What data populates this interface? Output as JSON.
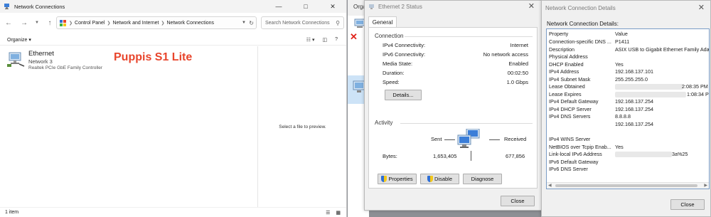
{
  "nc": {
    "title": "Network Connections",
    "addr_segments": [
      "Control Panel",
      "Network and Internet",
      "Network Connections"
    ],
    "search_placeholder": "Search Network Connections",
    "organize": "Organize",
    "item": {
      "name": "Ethernet",
      "network": "Network 3",
      "device": "Realtek PCIe GbE Family Controller"
    },
    "overlay_text": "Puppis S1 Lite",
    "preview_text": "Select a file to preview.",
    "status_text": "1 item"
  },
  "mid": {
    "org": "Orga"
  },
  "status": {
    "title": "Ethernet 2 Status",
    "tab": "General",
    "connection_label": "Connection",
    "rows": [
      {
        "k": "IPv4 Connectivity:",
        "v": "Internet"
      },
      {
        "k": "IPv6 Connectivity:",
        "v": "No network access"
      },
      {
        "k": "Media State:",
        "v": "Enabled"
      },
      {
        "k": "Duration:",
        "v": "00:02:50"
      },
      {
        "k": "Speed:",
        "v": "1.0 Gbps"
      }
    ],
    "details_btn": "Details...",
    "activity_label": "Activity",
    "sent_label": "Sent",
    "received_label": "Received",
    "bytes_label": "Bytes:",
    "bytes_sent": "1,653,405",
    "bytes_received": "677,856",
    "properties_btn": "Properties",
    "disable_btn": "Disable",
    "diagnose_btn": "Diagnose",
    "close_btn": "Close"
  },
  "details": {
    "title": "Network Connection Details",
    "label": "Network Connection Details:",
    "header": {
      "p": "Property",
      "v": "Value"
    },
    "rows": [
      {
        "p": "Connection-specific DNS ...",
        "v": "P1411"
      },
      {
        "p": "Description",
        "v": "ASIX USB to Gigabit Ethernet Family Ada"
      },
      {
        "p": "Physical Address",
        "v": ""
      },
      {
        "p": "DHCP Enabled",
        "v": "Yes"
      },
      {
        "p": "IPv4 Address",
        "v": "192.168.137.101"
      },
      {
        "p": "IPv4 Subnet Mask",
        "v": "255.255.255.0"
      },
      {
        "p": "Lease Obtained",
        "v": "2:08:35 PM"
      },
      {
        "p": "Lease Expires",
        "v": "1:08:34 PM"
      },
      {
        "p": "IPv4 Default Gateway",
        "v": "192.168.137.254"
      },
      {
        "p": "IPv4 DHCP Server",
        "v": "192.168.137.254"
      },
      {
        "p": "IPv4 DNS Servers",
        "v": "8.8.8.8"
      },
      {
        "p": "",
        "v": "192.168.137.254"
      },
      {
        "p": "IPv4 WINS Server",
        "v": ""
      },
      {
        "p": "NetBIOS over Tcpip Enab...",
        "v": "Yes"
      },
      {
        "p": "Link-local IPv6 Address",
        "v": "3a%25"
      },
      {
        "p": "IPv6 Default Gateway",
        "v": ""
      },
      {
        "p": "IPv6 DNS Server",
        "v": ""
      }
    ],
    "close_btn": "Close"
  },
  "colors": {
    "overlay": "#e8452c",
    "accent": "#2f6fd5"
  }
}
